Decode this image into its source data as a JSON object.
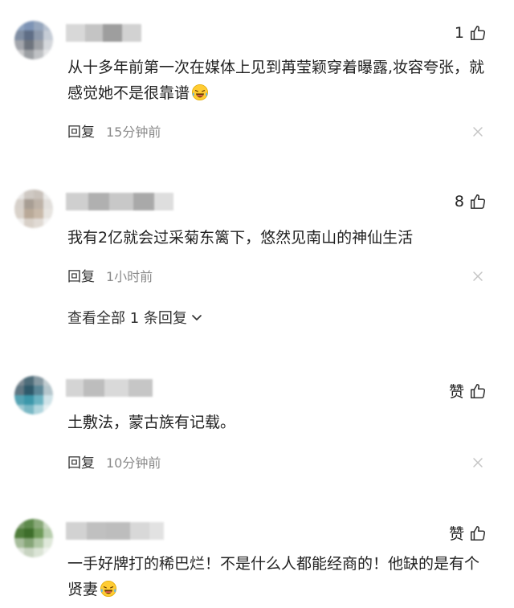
{
  "comments": [
    {
      "likes": "1",
      "text": "从十多年前第一次在媒体上见到苒莹颖穿着曝露,妆容夸张，就感觉她不是很靠谱",
      "emoji": "laughing-crying-emoji",
      "reply_label": "回复",
      "time": "15分钟前"
    },
    {
      "likes": "8",
      "text": "我有2亿就会过采菊东篱下，悠然见南山的神仙生活",
      "reply_label": "回复",
      "time": "1小时前",
      "view_all": "查看全部 1 条回复"
    },
    {
      "likes": "赞",
      "text": "土敷法，蒙古族有记载。",
      "reply_label": "回复",
      "time": "10分钟前"
    },
    {
      "likes": "赞",
      "text": "一手好牌打的稀巴烂！不是什么人都能经商的！他缺的是有个贤妻",
      "emoji": "laughing-crying-emoji"
    }
  ],
  "icons": {
    "like": "thumb-up-icon",
    "dismiss": "close-icon",
    "expand": "chevron-down-icon"
  },
  "colors": {
    "text": "#222222",
    "muted": "#8a8a8a",
    "icon": "#333333",
    "close": "#c4c4c4"
  }
}
